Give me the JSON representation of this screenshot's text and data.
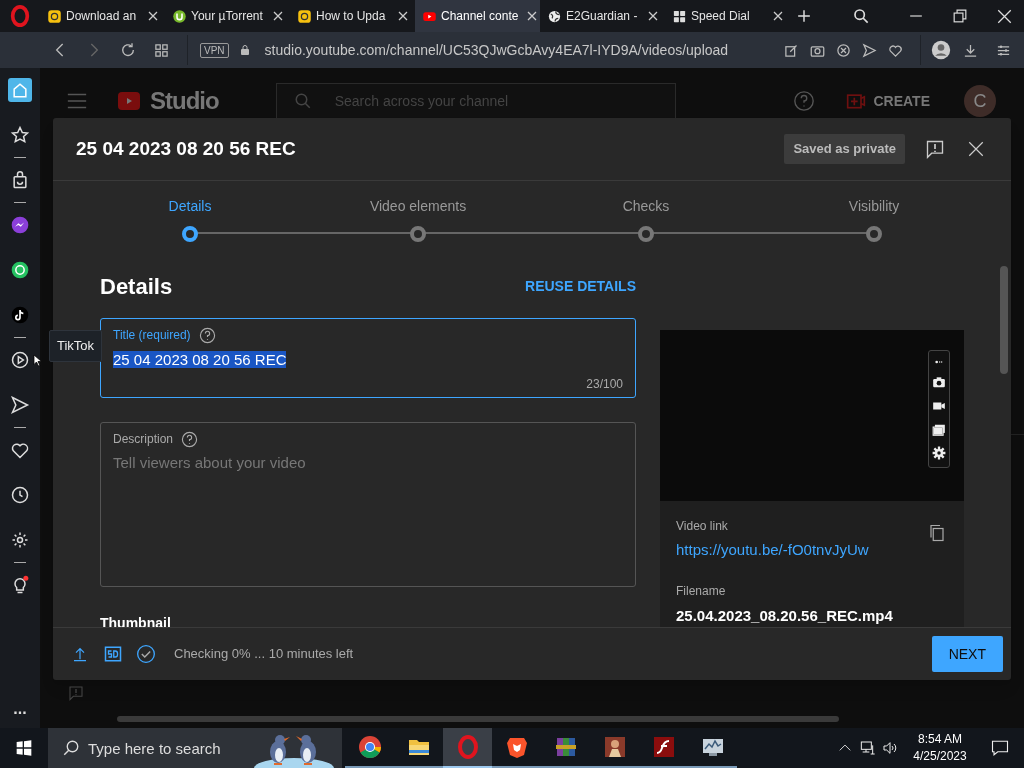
{
  "browser": {
    "tabs": [
      {
        "title": "Download an",
        "kind": "yellow",
        "selected": false
      },
      {
        "title": "Your µTorrent",
        "kind": "utorrent",
        "selected": false
      },
      {
        "title": "How to Upda",
        "kind": "yellow",
        "selected": false
      },
      {
        "title": "Channel conte",
        "kind": "youtube",
        "selected": true
      },
      {
        "title": "E2Guardian -",
        "kind": "globe",
        "selected": false
      },
      {
        "title": "Speed Dial",
        "kind": "grid",
        "selected": false
      }
    ],
    "vpn": "VPN",
    "url": "studio.youtube.com/channel/UC53QJwGcbAvy4EA7l-IYD9A/videos/upload"
  },
  "sidebar": {
    "items": [
      {
        "kind": "home",
        "selected": true
      },
      {
        "kind": "star",
        "selected": false
      },
      {
        "kind": "bag",
        "selected": false
      },
      {
        "kind": "messenger",
        "selected": false
      },
      {
        "kind": "whatsapp",
        "selected": false
      },
      {
        "kind": "tiktok",
        "selected": false
      },
      {
        "kind": "play",
        "selected": false
      },
      {
        "kind": "send",
        "selected": false
      },
      {
        "kind": "heart",
        "selected": false
      },
      {
        "kind": "clock",
        "selected": false
      },
      {
        "kind": "gear",
        "selected": false
      },
      {
        "kind": "bulb",
        "selected": false
      }
    ],
    "tooltip": "TikTok",
    "more": "..."
  },
  "studio": {
    "logo": "Studio",
    "search_placeholder": "Search across your channel",
    "create": "CREATE",
    "avatar": "C"
  },
  "dialog": {
    "title": "25 04 2023 08 20 56 REC",
    "status": "Saved as private",
    "steps": [
      {
        "label": "Details",
        "selected": true
      },
      {
        "label": "Video elements",
        "selected": false
      },
      {
        "label": "Checks",
        "selected": false
      },
      {
        "label": "Visibility",
        "selected": false
      }
    ],
    "heading": "Details",
    "reuse": "REUSE DETAILS",
    "title_field": {
      "label": "Title (required)",
      "value": "25 04 2023 08 20 56 REC",
      "count": "23/100"
    },
    "description_field": {
      "label": "Description",
      "placeholder": "Tell viewers about your video"
    },
    "thumbnail_heading": "Thumbnail",
    "video_link_label": "Video link",
    "video_link": "https://youtu.be/-fO0tnvJyUw",
    "filename_label": "Filename",
    "filename": "25.04.2023_08.20.56_REC.mp4",
    "progress": "Checking 0% ... 10 minutes left",
    "next": "NEXT"
  },
  "taskbar": {
    "search_placeholder": "Type here to search",
    "apps": [
      {
        "kind": "chrome",
        "selected": false
      },
      {
        "kind": "folder",
        "selected": false
      },
      {
        "kind": "opera",
        "selected": true
      },
      {
        "kind": "brave",
        "selected": false
      },
      {
        "kind": "winrar",
        "selected": false
      },
      {
        "kind": "game",
        "selected": false
      },
      {
        "kind": "flash",
        "selected": false
      },
      {
        "kind": "monitor",
        "selected": false
      }
    ],
    "time": "8:54 AM",
    "date": "4/25/2023"
  }
}
